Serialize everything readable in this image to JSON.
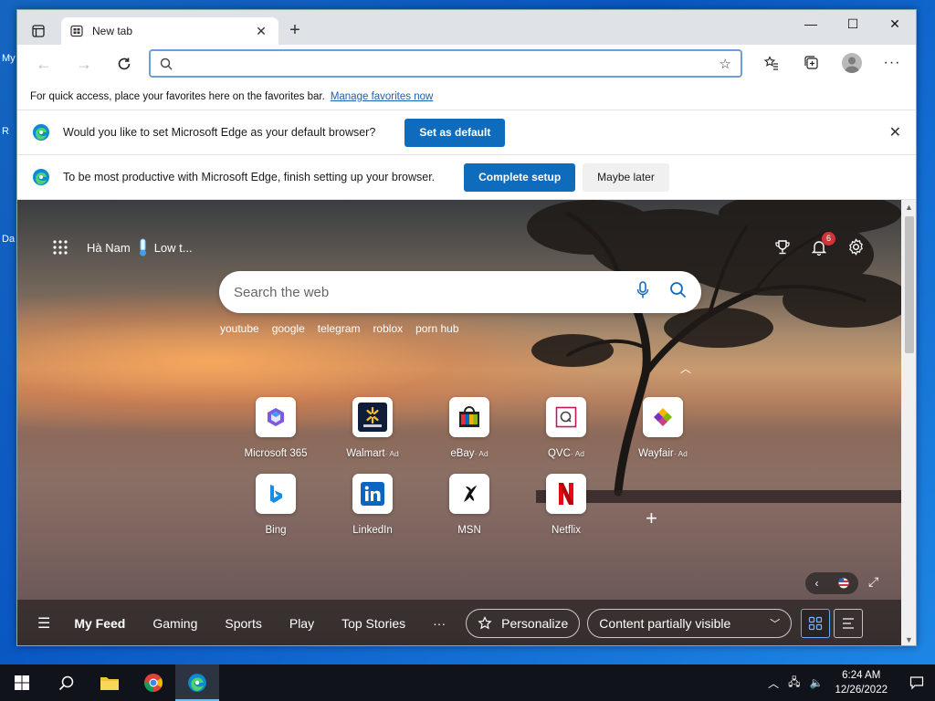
{
  "desktop": {
    "fragments": [
      "My",
      "R",
      "Da"
    ]
  },
  "browser": {
    "tab": {
      "title": "New tab",
      "close": "✕",
      "new": "+"
    },
    "window_controls": {
      "minimize": "—",
      "maximize": "☐",
      "close": "✕"
    },
    "address": {
      "value": "",
      "placeholder": ""
    },
    "favorites_bar": {
      "text": "For quick access, place your favorites here on the favorites bar.",
      "link": "Manage favorites now"
    },
    "default_bar": {
      "message": "Would you like to set Microsoft Edge as your default browser?",
      "button": "Set as default"
    },
    "setup_bar": {
      "message": "To be most productive with Microsoft Edge, finish setting up your browser.",
      "primary": "Complete setup",
      "secondary": "Maybe later"
    }
  },
  "ntp": {
    "location": "Hà Nam",
    "weather": "Low t...",
    "notifications_count": "6",
    "search_placeholder": "Search the web",
    "trending": [
      "youtube",
      "google",
      "telegram",
      "roblox",
      "porn hub"
    ],
    "tiles": [
      {
        "label": "Microsoft 365",
        "ad": ""
      },
      {
        "label": "Walmart",
        "ad": "· Ad"
      },
      {
        "label": "eBay",
        "ad": "· Ad"
      },
      {
        "label": "QVC",
        "ad": "· Ad"
      },
      {
        "label": "Wayfair",
        "ad": "· Ad"
      },
      {
        "label": "Bing",
        "ad": ""
      },
      {
        "label": "LinkedIn",
        "ad": ""
      },
      {
        "label": "MSN",
        "ad": ""
      },
      {
        "label": "Netflix",
        "ad": ""
      }
    ],
    "feed": {
      "items": [
        "My Feed",
        "Gaming",
        "Sports",
        "Play",
        "Top Stories"
      ],
      "more": "···",
      "personalize": "Personalize",
      "content_visibility": "Content partially visible"
    }
  },
  "taskbar": {
    "time": "6:24 AM",
    "date": "12/26/2022"
  },
  "colors": {
    "accent": "#0f6cbd",
    "taskbar": "#101319",
    "badge": "#d13438"
  }
}
